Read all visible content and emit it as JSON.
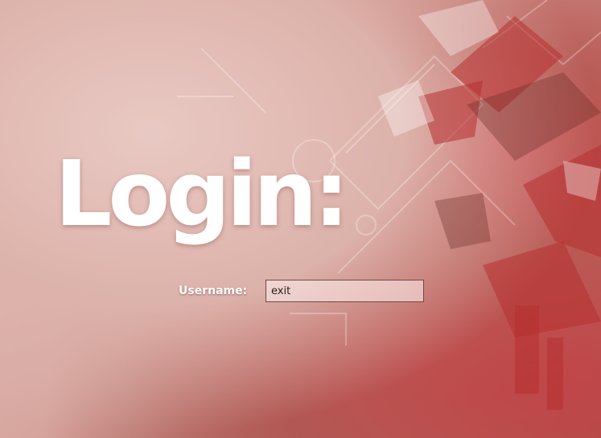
{
  "login": {
    "title": "Login:",
    "username_label": "Username:",
    "username_value": "exit"
  },
  "colors": {
    "background_light": "#e6c6bf",
    "background_accent": "#c84a4e",
    "text": "#ffffff"
  }
}
